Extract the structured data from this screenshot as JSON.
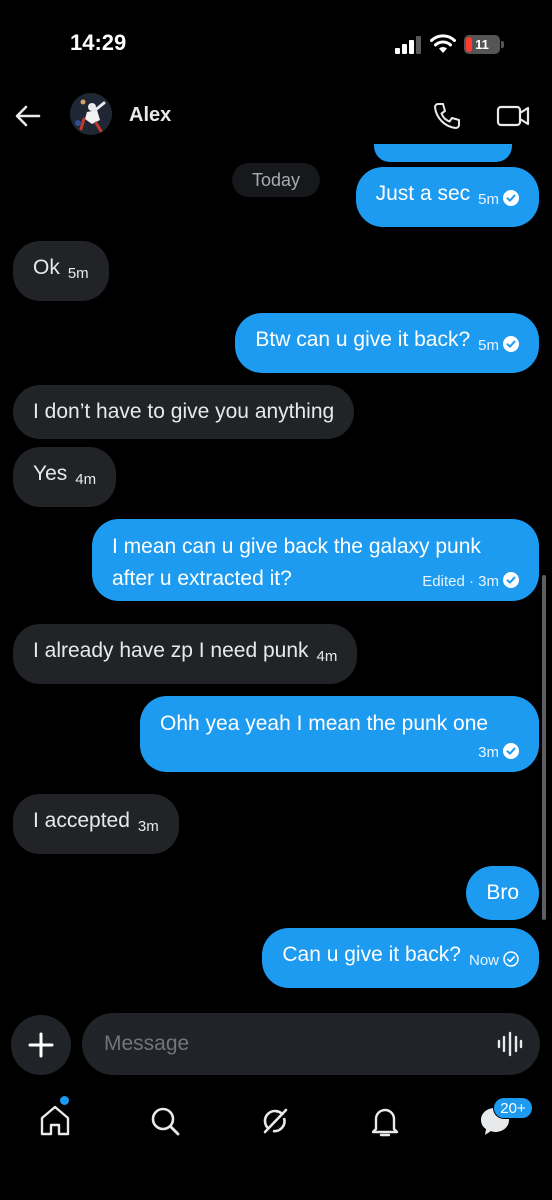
{
  "status_bar": {
    "time": "14:29",
    "battery_level": "11"
  },
  "header": {
    "contact_name": "Alex"
  },
  "date_separator": "Today",
  "messages": [
    {
      "dir": "out",
      "text": "Just a sec",
      "time": "5m",
      "status": "read"
    },
    {
      "dir": "in",
      "text": "Ok",
      "time": "5m"
    },
    {
      "dir": "out",
      "text": "Btw can u give it back?",
      "time": "5m",
      "status": "read"
    },
    {
      "dir": "in",
      "text": "I don’t have to give you anything",
      "time": ""
    },
    {
      "dir": "in",
      "text": "Yes",
      "time": "4m"
    },
    {
      "dir": "out",
      "text": "I mean can u give back the galaxy punk after u extracted it?",
      "time": "Edited · 3m",
      "status": "read"
    },
    {
      "dir": "in",
      "text": "I already have zp I need punk",
      "time": "4m"
    },
    {
      "dir": "out",
      "text": "Ohh yea yeah I mean the punk one",
      "time": "3m",
      "status": "read"
    },
    {
      "dir": "in",
      "text": "I accepted",
      "time": "3m"
    },
    {
      "dir": "out",
      "text": "Bro",
      "time": ""
    },
    {
      "dir": "out",
      "text": "Can u give it back?",
      "time": "Now",
      "status": "sent"
    }
  ],
  "composer": {
    "placeholder": "Message"
  },
  "nav": {
    "items": [
      "home-icon",
      "search-icon",
      "grok-icon",
      "notifications-icon",
      "messages-icon"
    ],
    "messages_badge": "20+"
  },
  "colors": {
    "accent": "#1d9bf0",
    "incoming_bubble": "#212327",
    "background": "#000000"
  }
}
